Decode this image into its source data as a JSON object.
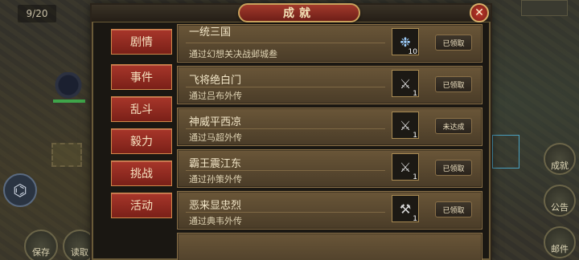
{
  "hud": {
    "counter": "9/20",
    "gift_glyph": "⌬",
    "bottom_left_buttons": [
      "保存",
      "读取"
    ],
    "side_buttons": [
      "成就",
      "公告",
      "邮件"
    ]
  },
  "panel": {
    "title": "成就",
    "close_glyph": "✕"
  },
  "tabs": [
    "剧情",
    "事件",
    "乱斗",
    "毅力",
    "挑战",
    "活动"
  ],
  "achievements": [
    {
      "title": "一统三国",
      "desc": "通过幻想关决战邺城叁",
      "item_icon": "crystal-icon",
      "item_glyph": "❉",
      "count": "10",
      "status": "已领取"
    },
    {
      "title": "飞将绝白门",
      "desc": "通过吕布外传",
      "item_icon": "halberd-icon",
      "item_glyph": "⚔",
      "count": "1",
      "status": "已领取"
    },
    {
      "title": "神威平西凉",
      "desc": "通过马超外传",
      "item_icon": "spear-icon",
      "item_glyph": "⚔",
      "count": "1",
      "status": "未达成"
    },
    {
      "title": "霸王震江东",
      "desc": "通过孙策外传",
      "item_icon": "spear-icon",
      "item_glyph": "⚔",
      "count": "1",
      "status": "已领取"
    },
    {
      "title": "恶来显忠烈",
      "desc": "通过典韦外传",
      "item_icon": "dual-axes-icon",
      "item_glyph": "⚒",
      "count": "1",
      "status": "已领取"
    },
    {
      "title": "",
      "desc": "",
      "item_icon": "",
      "item_glyph": "",
      "count": "",
      "status": ""
    }
  ]
}
